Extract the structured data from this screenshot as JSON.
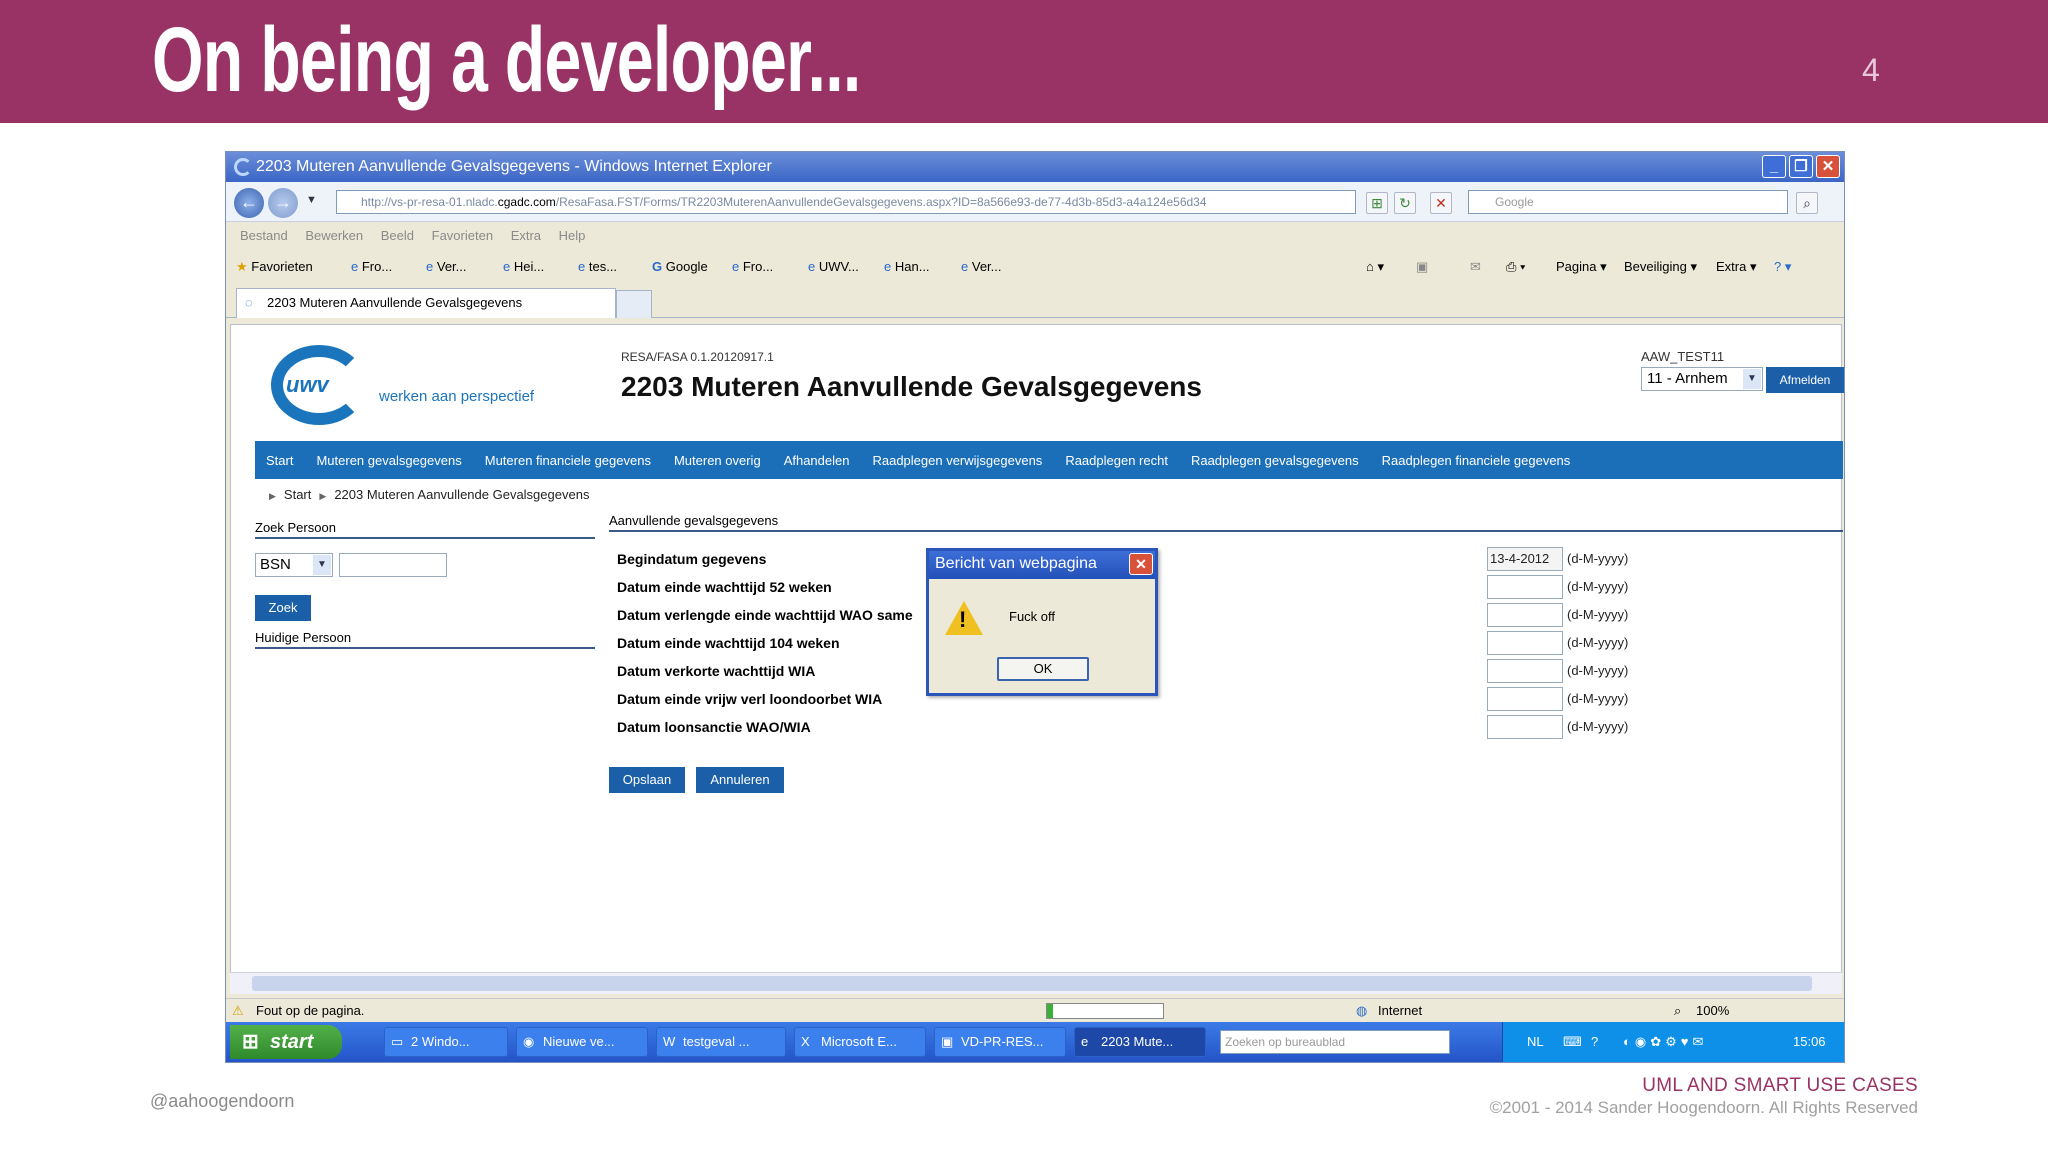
{
  "slide": {
    "title": "On being a developer...",
    "number": "4",
    "handle": "@aahoogendoorn",
    "footer_title": "UML AND SMART USE CASES",
    "footer_copyright": "©2001 - 2014 Sander Hoogendoorn. All Rights Reserved"
  },
  "browser": {
    "window_title": "2203 Muteren Aanvullende Gevalsgegevens - Windows Internet Explorer",
    "url_prefix": "http://vs-pr-resa-01.nladc.",
    "url_domain": "cgadc.com",
    "url_path": "/ResaFasa.FST/Forms/TR2203MuterenAanvullendeGevalsgegevens.aspx?ID=8a566e93-de77-4d3b-85d3-a4a124e56d34",
    "search_placeholder": "Google",
    "menu": [
      "Bestand",
      "Bewerken",
      "Beeld",
      "Favorieten",
      "Extra",
      "Help"
    ],
    "favorites_label": "Favorieten",
    "favorites": [
      "Fro...",
      "Ver...",
      "Hei...",
      "tes...",
      "Google",
      "Fro...",
      "UWV...",
      "Han...",
      "Ver..."
    ],
    "command_bar": [
      "Pagina",
      "Beveiliging",
      "Extra"
    ],
    "tab_label": "2203 Muteren Aanvullende Gevalsgegevens",
    "status_text": "Fout op de pagina.",
    "zone": "Internet",
    "zoom": "100%"
  },
  "app": {
    "logo_text": "uwv",
    "slogan": "werken aan perspectief",
    "version": "RESA/FASA 0.1.20120917.1",
    "page_title": "2203 Muteren Aanvullende Gevalsgegevens",
    "user": "AAW_TEST11",
    "location": "11 - Arnhem",
    "logout": "Afmelden",
    "nav": [
      "Start",
      "Muteren gevalsgegevens",
      "Muteren financiele gegevens",
      "Muteren overig",
      "Afhandelen",
      "Raadplegen verwijsgegevens",
      "Raadplegen recht",
      "Raadplegen gevalsgegevens",
      "Raadplegen financiele gegevens"
    ],
    "breadcrumb": [
      "Start",
      "2203 Muteren Aanvullende Gevalsgegevens"
    ],
    "search_header": "Zoek Persoon",
    "search_type": "BSN",
    "search_button": "Zoek",
    "current_person": "Huidige Persoon",
    "section_header": "Aanvullende gevalsgegevens",
    "fields": [
      {
        "label": "Begindatum gegevens",
        "value": "13-4-2012",
        "format": "(d-M-yyyy)"
      },
      {
        "label": "Datum einde wachttijd 52 weken",
        "value": "",
        "format": "(d-M-yyyy)"
      },
      {
        "label": "Datum verlengde einde wachttijd WAO same",
        "value": "",
        "format": "(d-M-yyyy)"
      },
      {
        "label": "Datum einde wachttijd 104 weken",
        "value": "",
        "format": "(d-M-yyyy)"
      },
      {
        "label": "Datum verkorte wachttijd WIA",
        "value": "",
        "format": "(d-M-yyyy)"
      },
      {
        "label": "Datum einde vrijw verl loondoorbet WIA",
        "value": "",
        "format": "(d-M-yyyy)"
      },
      {
        "label": "Datum loonsanctie WAO/WIA",
        "value": "",
        "format": "(d-M-yyyy)"
      }
    ],
    "save_button": "Opslaan",
    "cancel_button": "Annuleren"
  },
  "dialog": {
    "title": "Bericht van webpagina",
    "message": "Fuck off",
    "ok": "OK"
  },
  "taskbar": {
    "start": "start",
    "items": [
      "2 Windo...",
      "Nieuwe ve...",
      "testgeval ...",
      "Microsoft E...",
      "VD-PR-RES...",
      "2203 Mute..."
    ],
    "search_placeholder": "Zoeken op bureaublad",
    "language": "NL",
    "clock": "15:06"
  }
}
